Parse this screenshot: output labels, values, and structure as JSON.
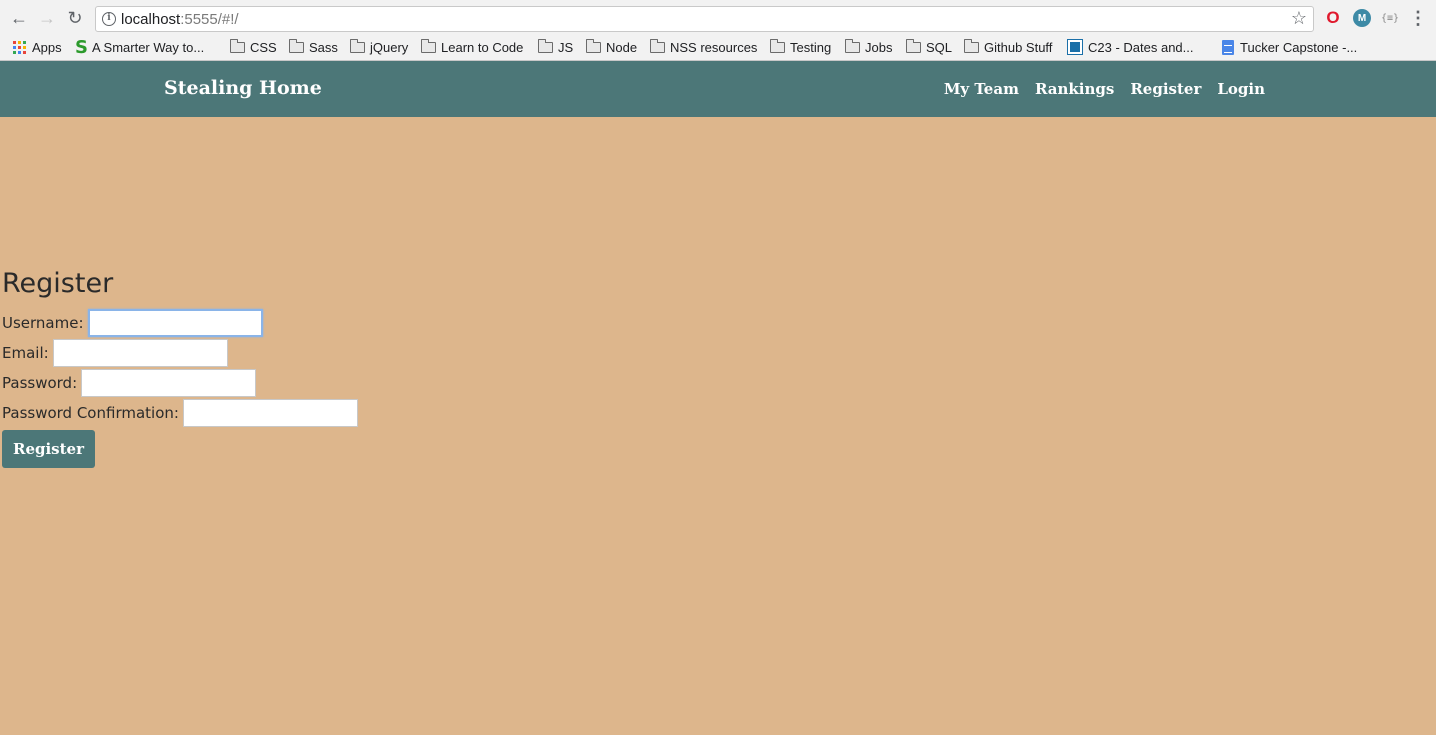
{
  "browser": {
    "url_host": "localhost",
    "url_rest": ":5555/#!/",
    "bookmarks": {
      "apps": "Apps",
      "smarter_way": "A Smarter Way to...",
      "css": "CSS",
      "sass": "Sass",
      "jquery": "jQuery",
      "learn_to_code": "Learn to Code",
      "js": "JS",
      "node": "Node",
      "nss_resources": "NSS resources",
      "testing": "Testing",
      "jobs": "Jobs",
      "sql": "SQL",
      "github_stuff": "Github Stuff",
      "c23": "C23 - Dates and...",
      "tucker_capstone": "Tucker Capstone -..."
    },
    "extensions": {
      "m_label": "M",
      "json_label": "{≡}"
    }
  },
  "navbar": {
    "brand": "Stealing Home",
    "links": {
      "my_team": "My Team",
      "rankings": "Rankings",
      "register": "Register",
      "login": "Login"
    }
  },
  "register": {
    "title": "Register",
    "username_label": "Username:",
    "username_value": "",
    "email_label": "Email:",
    "email_value": "",
    "password_label": "Password:",
    "password_value": "",
    "confirm_label": "Password Confirmation:",
    "confirm_value": "",
    "submit_label": "Register"
  },
  "colors": {
    "page_background": "#ddb68c",
    "navbar": "#4c7778",
    "button": "#4c7778"
  }
}
